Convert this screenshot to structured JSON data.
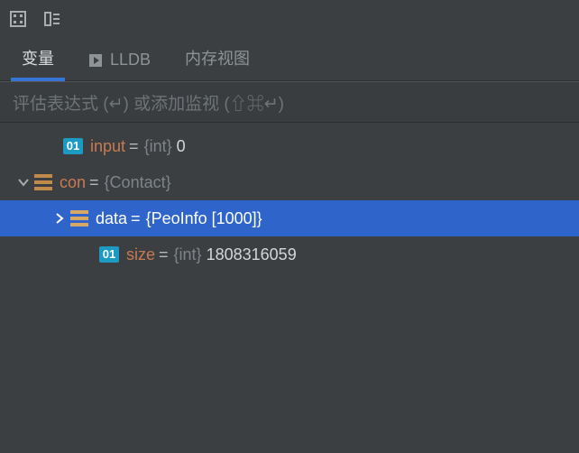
{
  "toolbar": {
    "calc_icon": "calculator-icon",
    "layout_icon": "layout-icon"
  },
  "tabs": {
    "variables": "变量",
    "lldb": "LLDB",
    "memory": "内存视图"
  },
  "eval_placeholder": "评估表达式 (↵) 或添加监视 (⇧⌘↵)",
  "badges": {
    "primitive": "01"
  },
  "vars": {
    "input": {
      "name": "input",
      "type": "{int}",
      "value": "0"
    },
    "con": {
      "name": "con",
      "type": "{Contact}"
    },
    "data": {
      "name": "data",
      "type": "{PeoInfo [1000]}"
    },
    "size": {
      "name": "size",
      "type": "{int}",
      "value": "1808316059"
    }
  }
}
